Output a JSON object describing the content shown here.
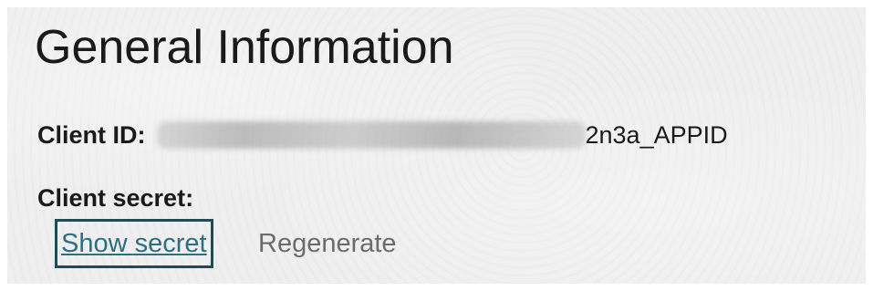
{
  "section": {
    "title": "General Information"
  },
  "client_id": {
    "label": "Client ID:",
    "visible_suffix": "2n3a_APPID"
  },
  "client_secret": {
    "label": "Client secret:",
    "show_secret_label": "Show secret",
    "regenerate_label": "Regenerate"
  },
  "colors": {
    "link": "#2b6f80",
    "focus_border": "#1f4b55",
    "muted_action": "#6b6b6b",
    "text": "#1a1a1a",
    "panel_background": "#eeeeee"
  }
}
